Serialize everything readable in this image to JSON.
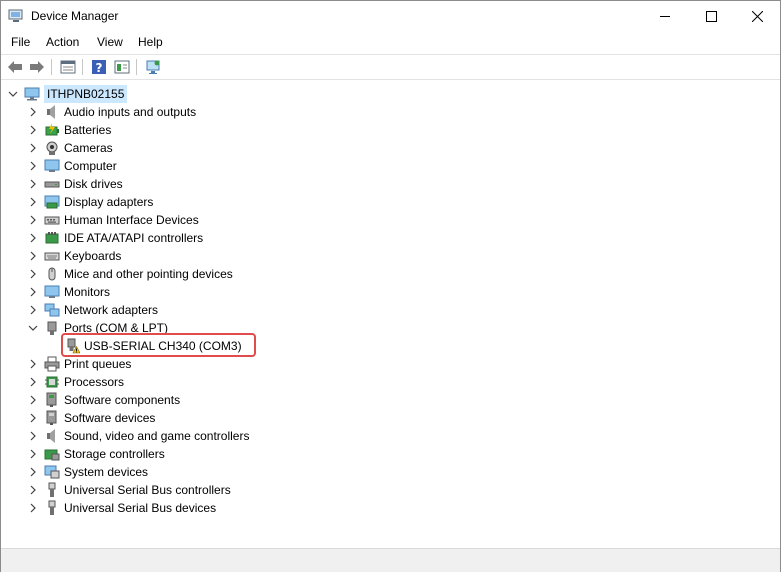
{
  "window": {
    "title": "Device Manager",
    "title_icon": "device-manager-icon",
    "controls": [
      "minimize-icon",
      "maximize-icon",
      "close-icon"
    ]
  },
  "menu": {
    "items": [
      "File",
      "Action",
      "View",
      "Help"
    ]
  },
  "toolbar": {
    "buttons": [
      "back-arrow-icon",
      "forward-arrow-icon",
      "properties-icon",
      "help-icon",
      "update-driver-icon",
      "scan-hardware-icon"
    ]
  },
  "tree": {
    "root": {
      "label": "ITHPNB02155",
      "icon": "computer-icon",
      "expanded": true,
      "selected": true
    },
    "categories": [
      {
        "label": "Audio inputs and outputs",
        "icon": "speaker-icon",
        "expanded": false
      },
      {
        "label": "Batteries",
        "icon": "battery-icon",
        "expanded": false
      },
      {
        "label": "Cameras",
        "icon": "camera-icon",
        "expanded": false
      },
      {
        "label": "Computer",
        "icon": "monitor-icon",
        "expanded": false
      },
      {
        "label": "Disk drives",
        "icon": "disk-drive-icon",
        "expanded": false
      },
      {
        "label": "Display adapters",
        "icon": "display-adapter-icon",
        "expanded": false
      },
      {
        "label": "Human Interface Devices",
        "icon": "hid-icon",
        "expanded": false
      },
      {
        "label": "IDE ATA/ATAPI controllers",
        "icon": "ide-controller-icon",
        "expanded": false
      },
      {
        "label": "Keyboards",
        "icon": "keyboard-icon",
        "expanded": false
      },
      {
        "label": "Mice and other pointing devices",
        "icon": "mouse-icon",
        "expanded": false
      },
      {
        "label": "Monitors",
        "icon": "monitor-icon",
        "expanded": false
      },
      {
        "label": "Network adapters",
        "icon": "network-icon",
        "expanded": false
      },
      {
        "label": "Ports (COM & LPT)",
        "icon": "port-icon",
        "expanded": true,
        "children": [
          {
            "label": "USB-SERIAL CH340 (COM3)",
            "icon": "port-warning-icon",
            "status": "warning",
            "highlighted": true
          }
        ]
      },
      {
        "label": "Print queues",
        "icon": "printer-icon",
        "expanded": false
      },
      {
        "label": "Processors",
        "icon": "processor-icon",
        "expanded": false
      },
      {
        "label": "Software components",
        "icon": "software-component-icon",
        "expanded": false
      },
      {
        "label": "Software devices",
        "icon": "software-device-icon",
        "expanded": false
      },
      {
        "label": "Sound, video and game controllers",
        "icon": "speaker-icon",
        "expanded": false
      },
      {
        "label": "Storage controllers",
        "icon": "storage-controller-icon",
        "expanded": false
      },
      {
        "label": "System devices",
        "icon": "system-devices-icon",
        "expanded": false
      },
      {
        "label": "Universal Serial Bus controllers",
        "icon": "usb-icon",
        "expanded": false
      },
      {
        "label": "Universal Serial Bus devices",
        "icon": "usb-icon",
        "expanded": false
      }
    ]
  },
  "colors": {
    "selection": "#cce8ff",
    "highlight_border": "#e04b4b",
    "warning": "#f5c518"
  }
}
